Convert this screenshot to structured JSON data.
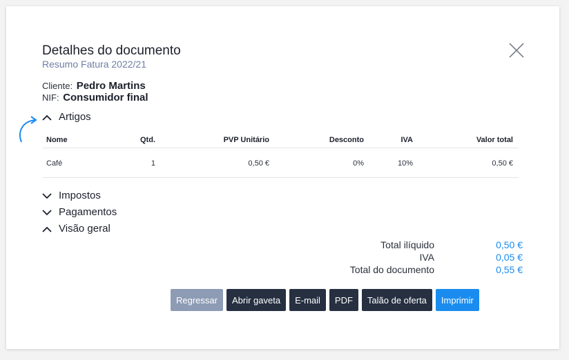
{
  "dialog": {
    "title": "Detalhes do documento",
    "subtitle": "Resumo Fatura 2022/21"
  },
  "client": {
    "label": "Cliente:",
    "name": "Pedro Martins",
    "nif_label": "NIF:",
    "nif_value": "Consumidor final"
  },
  "sections": {
    "artigos": "Artigos",
    "impostos": "Impostos",
    "pagamentos": "Pagamentos",
    "visao_geral": "Visão geral"
  },
  "table": {
    "headers": [
      "Nome",
      "Qtd.",
      "PVP Unitário",
      "Desconto",
      "IVA",
      "Valor total"
    ],
    "rows": [
      [
        "Café",
        "1",
        "0,50 €",
        "0%",
        "10%",
        "0,50 €"
      ]
    ]
  },
  "totals": {
    "items": [
      {
        "label": "Total ilíquido",
        "value": "0,50 €"
      },
      {
        "label": "IVA",
        "value": "0,05 €"
      },
      {
        "label": "Total do documento",
        "value": "0,55 €"
      }
    ]
  },
  "buttons": {
    "regressar": "Regressar",
    "abrir_gaveta": "Abrir gaveta",
    "email": "E-mail",
    "pdf": "PDF",
    "talao": "Talão de oferta",
    "imprimir": "Imprimir"
  },
  "colors": {
    "accent": "#1a8cf0",
    "dark_button": "#263041",
    "grey_button": "#8d9bb5",
    "subtitle": "#6f7ea3"
  },
  "icons": [
    "close-icon",
    "chevron-up-icon",
    "chevron-down-icon",
    "curved-arrow-icon"
  ]
}
